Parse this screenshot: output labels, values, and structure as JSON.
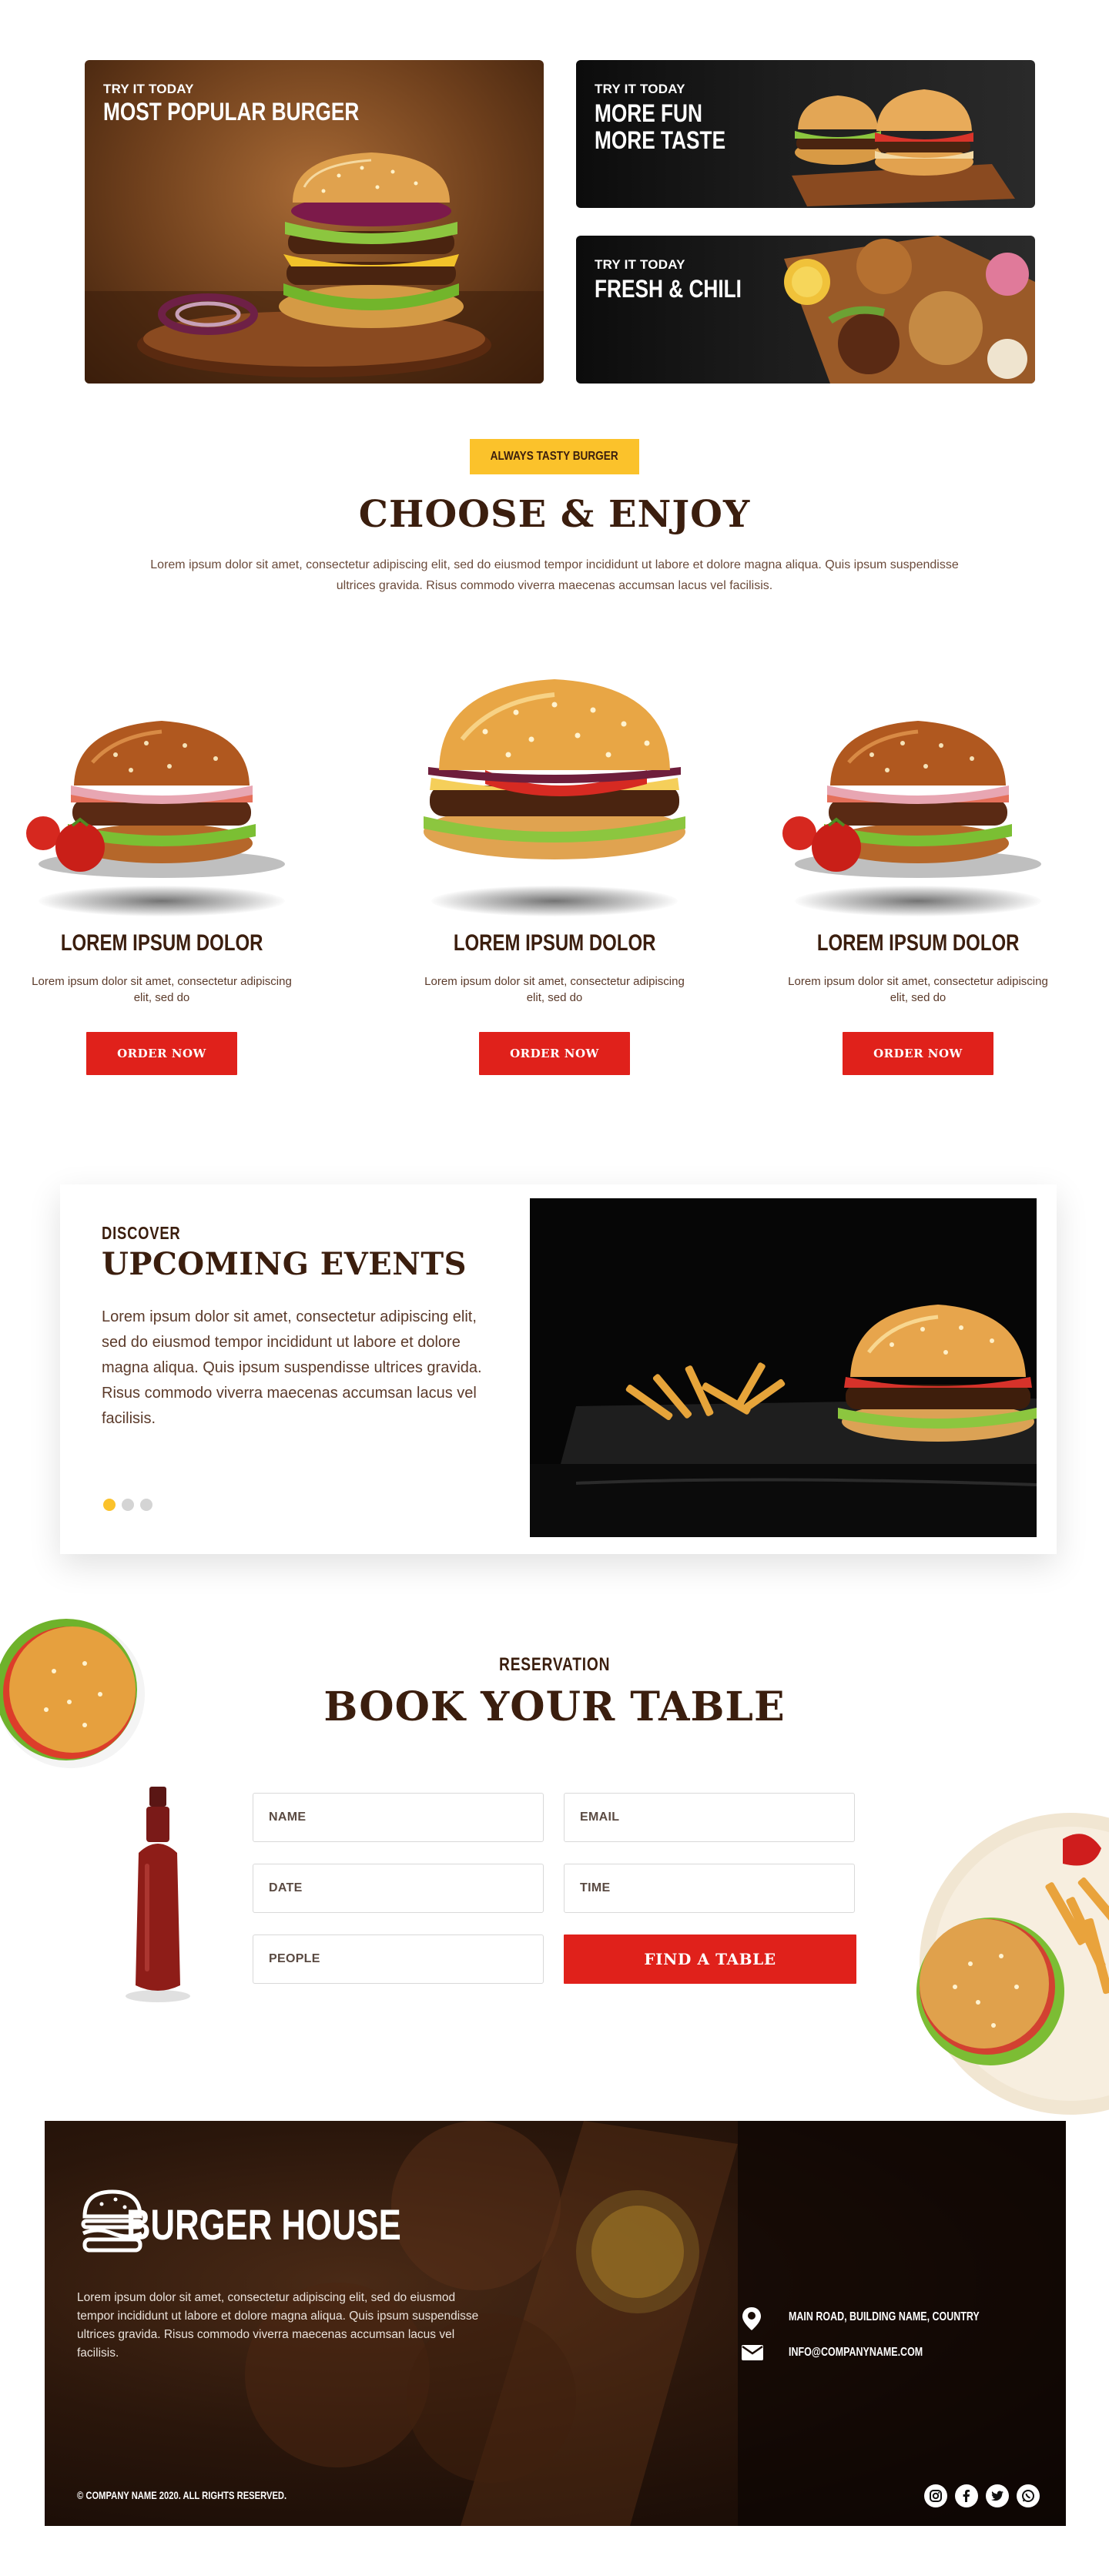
{
  "promos": [
    {
      "kicker": "TRY IT TODAY",
      "title": "MOST POPULAR BURGER"
    },
    {
      "kicker": "TRY IT TODAY",
      "title_line1": "MORE FUN",
      "title_line2": "MORE TASTE"
    },
    {
      "kicker": "TRY IT TODAY",
      "title": "FRESH & CHILI"
    }
  ],
  "menu": {
    "tag": "ALWAYS TASTY BURGER",
    "title": "CHOOSE & ENJOY",
    "lead": "Lorem ipsum dolor sit amet, consectetur adipiscing elit, sed do eiusmod tempor incididunt ut labore et dolore magna aliqua. Quis ipsum suspendisse ultrices gravida. Risus commodo viverra maecenas accumsan lacus vel facilisis.",
    "products": [
      {
        "name": "LOREM IPSUM DOLOR",
        "desc": "Lorem ipsum dolor sit amet, consectetur adipiscing elit, sed do",
        "button": "ORDER NOW"
      },
      {
        "name": "LOREM IPSUM DOLOR",
        "desc": "Lorem ipsum dolor sit amet, consectetur adipiscing elit, sed do",
        "button": "ORDER NOW"
      },
      {
        "name": "LOREM IPSUM DOLOR",
        "desc": "Lorem ipsum dolor sit amet, consectetur adipiscing elit, sed do",
        "button": "ORDER NOW"
      }
    ]
  },
  "events": {
    "kicker": "DISCOVER",
    "title": "UPCOMING EVENTS",
    "text": "Lorem ipsum dolor sit amet, consectetur adipiscing elit, sed do eiusmod tempor incididunt ut labore et dolore magna aliqua. Quis ipsum suspendisse ultrices gravida. Risus commodo viverra maecenas accumsan lacus vel facilisis.",
    "slides": 3,
    "active_slide": 1
  },
  "reservation": {
    "kicker": "RESERVATION",
    "title": "BOOK YOUR TABLE",
    "fields": {
      "name": "NAME",
      "email": "EMAIL",
      "date": "DATE",
      "time": "TIME",
      "people": "PEOPLE"
    },
    "button": "FIND A TABLE"
  },
  "footer": {
    "brand": "BURGER HOUSE",
    "text": "Lorem ipsum dolor sit amet, consectetur adipiscing elit, sed do eiusmod tempor incididunt ut labore et dolore magna aliqua. Quis ipsum suspendisse ultrices gravida. Risus commodo viverra maecenas accumsan lacus vel facilisis.",
    "address": "MAIN ROAD, BUILDING NAME, COUNTRY",
    "email": "INFO@COMPANYNAME.COM",
    "copyright": "© COMPANY NAME 2020. ALL RIGHTS RESERVED.",
    "social": [
      "instagram-icon",
      "facebook-icon",
      "twitter-icon",
      "whatsapp-icon"
    ]
  },
  "colors": {
    "brand_brown": "#3b1e0e",
    "accent_yellow": "#fbc22b",
    "accent_red": "#e0211b"
  }
}
